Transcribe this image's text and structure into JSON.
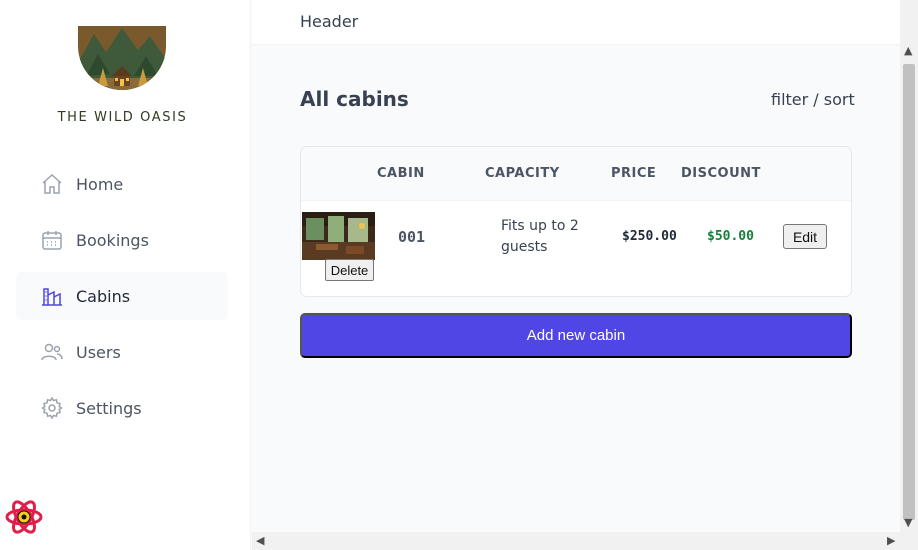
{
  "brand": {
    "name": "THE WILD OASIS"
  },
  "sidebar": {
    "items": [
      {
        "label": "Home",
        "icon": "home-icon",
        "active": false
      },
      {
        "label": "Bookings",
        "icon": "calendar-icon",
        "active": false
      },
      {
        "label": "Cabins",
        "icon": "cabins-icon",
        "active": true
      },
      {
        "label": "Users",
        "icon": "users-icon",
        "active": false
      },
      {
        "label": "Settings",
        "icon": "gear-icon",
        "active": false
      }
    ]
  },
  "header": {
    "text": "Header"
  },
  "main": {
    "title": "All cabins",
    "filter_label": "filter / sort",
    "table": {
      "columns": [
        "CABIN",
        "CAPACITY",
        "PRICE",
        "DISCOUNT"
      ],
      "rows": [
        {
          "name": "001",
          "capacity": "Fits up to 2 guests",
          "price": "$250.00",
          "discount": "$50.00",
          "delete_label": "Delete",
          "edit_label": "Edit"
        }
      ]
    },
    "add_button_label": "Add new cabin"
  },
  "colors": {
    "accent": "#4f46e5",
    "discount": "#15803d",
    "brand_text": "#2f3b23"
  }
}
